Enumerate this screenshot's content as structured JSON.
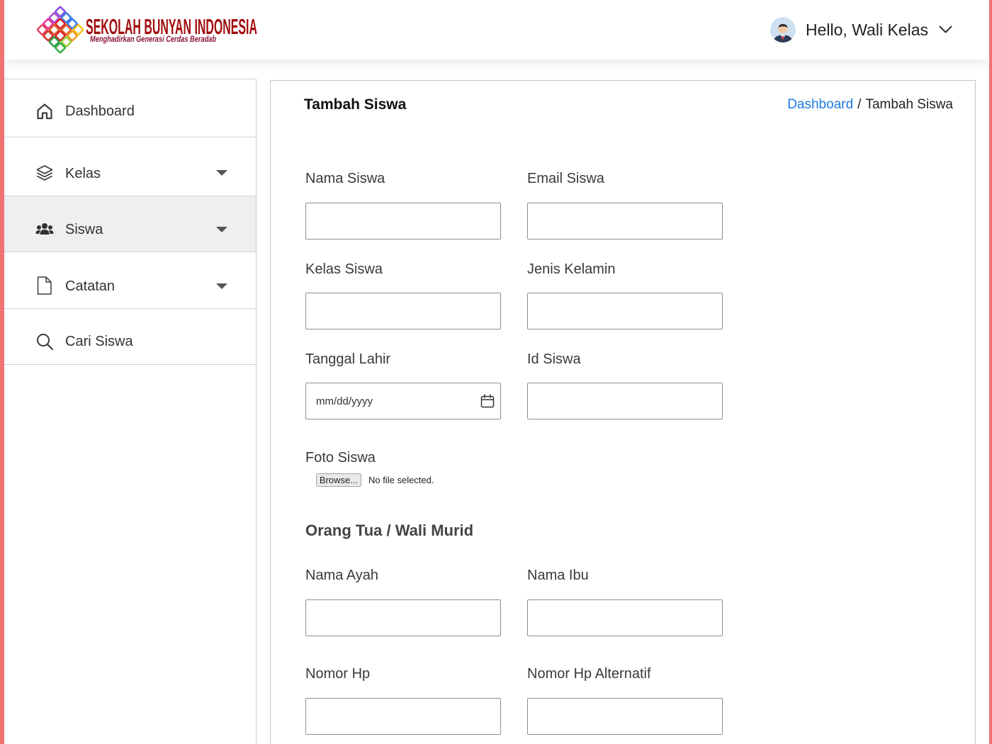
{
  "header": {
    "logo": {
      "title": "SEKOLAH BUNYAN INDONESIA",
      "tagline": "Menghadirkan Generasi Cerdas Beradab",
      "icon": "school-logo-icon"
    },
    "user_menu": {
      "greeting": "Hello, Wali Kelas",
      "avatar_icon": "user-avatar-icon",
      "dropdown_icon": "chevron-down-icon"
    }
  },
  "sidebar": {
    "items": [
      {
        "label": "Dashboard",
        "icon": "home-icon"
      },
      {
        "label": "Kelas",
        "icon": "layers-icon",
        "submenu_icon": "caret-down-icon"
      },
      {
        "label": "Siswa",
        "icon": "users-icon",
        "submenu_icon": "caret-down-icon",
        "active": true
      },
      {
        "label": "Catatan",
        "icon": "file-icon",
        "submenu_icon": "caret-down-icon"
      },
      {
        "label": "Cari Siswa",
        "icon": "search-icon"
      }
    ]
  },
  "main": {
    "title": "Tambah Siswa",
    "breadcrumb": {
      "home": "Dashboard",
      "separator": "/",
      "current": "Tambah Siswa"
    },
    "form": {
      "nama_siswa": {
        "label": "Nama Siswa",
        "value": ""
      },
      "email_siswa": {
        "label": "Email Siswa",
        "value": ""
      },
      "kelas_siswa": {
        "label": "Kelas Siswa",
        "value": ""
      },
      "jenis_kelamin": {
        "label": "Jenis Kelamin",
        "value": ""
      },
      "tanggal_lahir": {
        "label": "Tanggal Lahir",
        "placeholder": "mm/dd/yyyy",
        "icon": "calendar-icon"
      },
      "id_siswa": {
        "label": "Id Siswa",
        "value": ""
      },
      "foto_siswa": {
        "label": "Foto Siswa",
        "button": "Browse...",
        "status": "No file selected."
      },
      "parent_section_title": "Orang Tua / Wali Murid",
      "nama_ayah": {
        "label": "Nama Ayah",
        "value": ""
      },
      "nama_ibu": {
        "label": "Nama Ibu",
        "value": ""
      },
      "nomor_hp": {
        "label": "Nomor Hp",
        "value": ""
      },
      "nomor_hp_alternatif": {
        "label": "Nomor Hp Alternatif",
        "value": ""
      }
    }
  },
  "colors": {
    "edge_strip": "#ef7373",
    "logo_text": "#a10d0d",
    "breadcrumb_link": "#1b7ae4",
    "active_item_bg": "#efefef",
    "border": "#cccccc"
  }
}
